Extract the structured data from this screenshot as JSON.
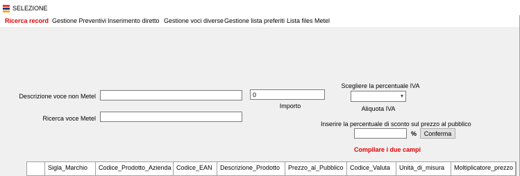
{
  "window": {
    "title": "SELEZIONE"
  },
  "tabs": [
    {
      "label": "Ricerca record"
    },
    {
      "label": "Gestione Preventivi"
    },
    {
      "label": "Inserimento diretto"
    },
    {
      "label": "Gestione voci diverse"
    },
    {
      "label": "Gestione lista preferiti"
    },
    {
      "label": "Lista files Metel"
    }
  ],
  "form": {
    "descrizione_label": "Descrizione voce non Metel",
    "descrizione_value": "",
    "ricerca_label": "Ricerca voce Metel",
    "ricerca_value": "",
    "importo_value": "0",
    "importo_label": "Importo",
    "iva_title": "Scegliere la percentuale IVA",
    "iva_selected": "",
    "aliquota_label": "Aliquota IVA",
    "sconto_title": "Inserire la percentuale di sconto sul prezzo al pubblico",
    "sconto_value": "",
    "percent_sign": "%",
    "conferma_label": "Conferma",
    "warning": "Compilare i due campi"
  },
  "grid": {
    "columns": [
      "",
      "Sigla_Marchio",
      "Codice_Prodotto_Azienda",
      "Codice_EAN",
      "Descrizione_Prodotto",
      "Prezzo_al_Pubblico",
      "Codice_Valuta",
      "Unità_di_misura",
      "Moltiplicatore_prezzo"
    ]
  },
  "colors": {
    "accent": "#e00000",
    "background": "#f0f0f0"
  },
  "icons": {
    "app": "app-logo-icon",
    "dropdown": "chevron-down-icon"
  }
}
